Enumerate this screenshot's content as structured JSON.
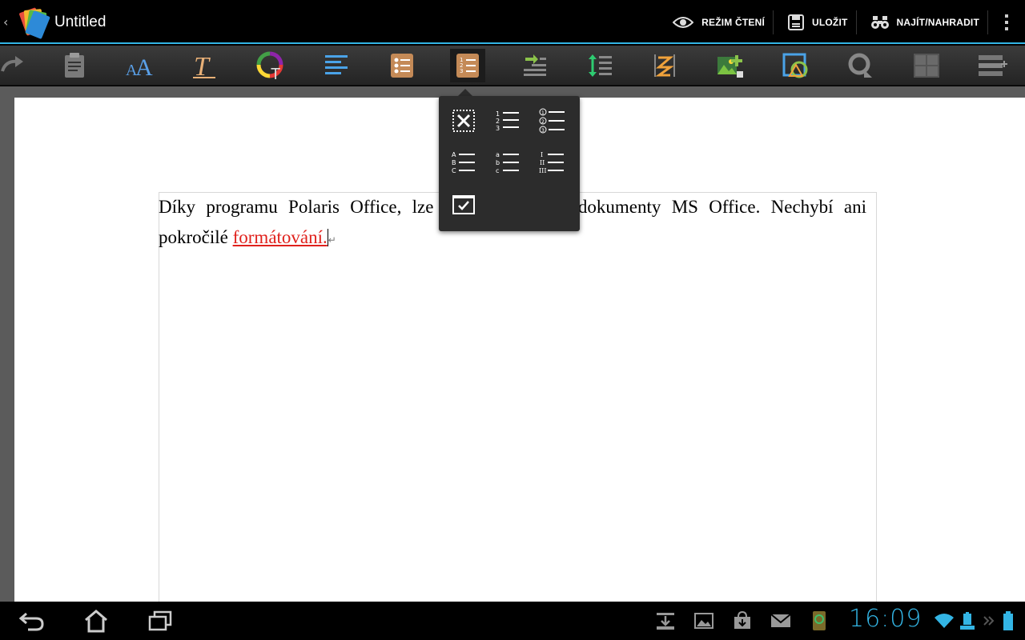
{
  "app": {
    "title": "Untitled"
  },
  "actions": {
    "read_mode": "REŽIM ČTENÍ",
    "save": "ULOŽIT",
    "find_replace": "NAJÍT/NAHRADIT"
  },
  "toolbar": {
    "items": [
      "undo-icon",
      "clipboard-icon",
      "font-size-icon",
      "text-style-icon",
      "font-color-icon",
      "align-icon",
      "bullet-list-icon",
      "numbered-list-icon",
      "indent-icon",
      "line-spacing-icon",
      "column-break-icon",
      "insert-image-icon",
      "shape-icon",
      "fill-icon",
      "table-icon",
      "insert-row-icon"
    ]
  },
  "document": {
    "text_before": "Díky programu Polaris Office, lze snadno vytvářet dokumenty MS Office. Nechybí ani pokročilé ",
    "text_red": "formátování.",
    "paragraph_mark": "↵"
  },
  "popup": {
    "options": [
      "no-list",
      "numbers-123",
      "circled-numbers",
      "upper-letters",
      "lower-letters",
      "roman-numerals",
      "checkbox"
    ]
  },
  "statusbar": {
    "time": "16:09"
  },
  "colors": {
    "accent": "#33b5e5",
    "red_text": "#e0211c"
  }
}
